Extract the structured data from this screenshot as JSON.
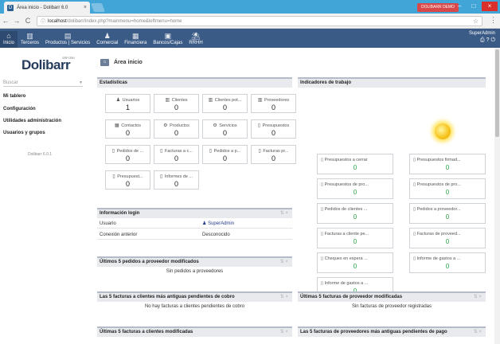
{
  "browser": {
    "tab_title": "Área inicio - Dolibarr 6.0",
    "profile": "DOLIBARR DEMO",
    "url_host": "localhost",
    "url_path": "/dolibarr/index.php?mainmenu=home&leftmenu=home"
  },
  "topmenu": {
    "items": [
      "Inicio",
      "Terceros",
      "Productos | Servicios",
      "Comercial",
      "Financiera",
      "Bancos/Cajas",
      "RRHH"
    ],
    "user": "SuperAdmin"
  },
  "left": {
    "logo": "Dolibarr",
    "logo_sub": "ERP CRM",
    "search_placeholder": "Buscar",
    "menu": [
      "Mi tablero",
      "Configuración",
      "Utilidades administración",
      "Usuarios y grupos"
    ],
    "version": "Dolibarr 6.0.1"
  },
  "page_title": "Área inicio",
  "stats": {
    "title": "Estadísticas",
    "boxes": [
      {
        "label": "Usuarios",
        "value": "1"
      },
      {
        "label": "Clientes",
        "value": "0"
      },
      {
        "label": "Clientes pot...",
        "value": "0"
      },
      {
        "label": "Proveedores",
        "value": "0"
      },
      {
        "label": "Contactos",
        "value": "0"
      },
      {
        "label": "Productos",
        "value": "0"
      },
      {
        "label": "Servicios",
        "value": "0"
      },
      {
        "label": "Presupuestos",
        "value": "0"
      },
      {
        "label": "Pedidos de ...",
        "value": "0"
      },
      {
        "label": "Facturas a c...",
        "value": "0"
      },
      {
        "label": "Pedidos a p...",
        "value": "0"
      },
      {
        "label": "Facturas pr...",
        "value": "0"
      },
      {
        "label": "Presupuest...",
        "value": "0"
      },
      {
        "label": "Informes de ...",
        "value": "0"
      }
    ]
  },
  "indicators": {
    "title": "Indicadores de trabajo",
    "boxes": [
      {
        "label": "Presupuestos a cerrar",
        "value": "0"
      },
      {
        "label": "Presupuestos firmad...",
        "value": "0"
      },
      {
        "label": "Presupuestos de pro...",
        "value": "0"
      },
      {
        "label": "Presupuestos de pro...",
        "value": "0"
      },
      {
        "label": "Pedidos de clientes ...",
        "value": "0"
      },
      {
        "label": "Pedidos a proveedor...",
        "value": "0"
      },
      {
        "label": "Facturas a cliente pe...",
        "value": "0"
      },
      {
        "label": "Facturas de proveed...",
        "value": "0"
      },
      {
        "label": "Cheques en espera ...",
        "value": "0"
      },
      {
        "label": "Informe de gastos a ...",
        "value": "0"
      },
      {
        "label": "Informe de gastos a ...",
        "value": "0"
      }
    ]
  },
  "login": {
    "title": "Información login",
    "user_label": "Usuario",
    "user_value": "SuperAdmin",
    "prev_label": "Conexión anterior",
    "prev_value": "Desconocido"
  },
  "panels": {
    "supplier_orders_title": "Últimos 5 pedidos a proveedor modificados",
    "supplier_orders_empty": "Sin pedidos a proveedores",
    "cust_unpaid_title": "Las 5 facturas a clientes más antiguas pendientes de cobro",
    "cust_unpaid_empty": "No hay facturas a clientes pendientes de cobro",
    "cust_modified_title": "Últimas 5 facturas a clientes modificadas",
    "supplier_inv_title": "Últimas 5 facturas de proveedor modificadas",
    "supplier_inv_empty": "Sin facturas de proveedor registradas",
    "supplier_unpaid_title": "Las 5 facturas de proveedores más antiguas pendientes de pago"
  }
}
